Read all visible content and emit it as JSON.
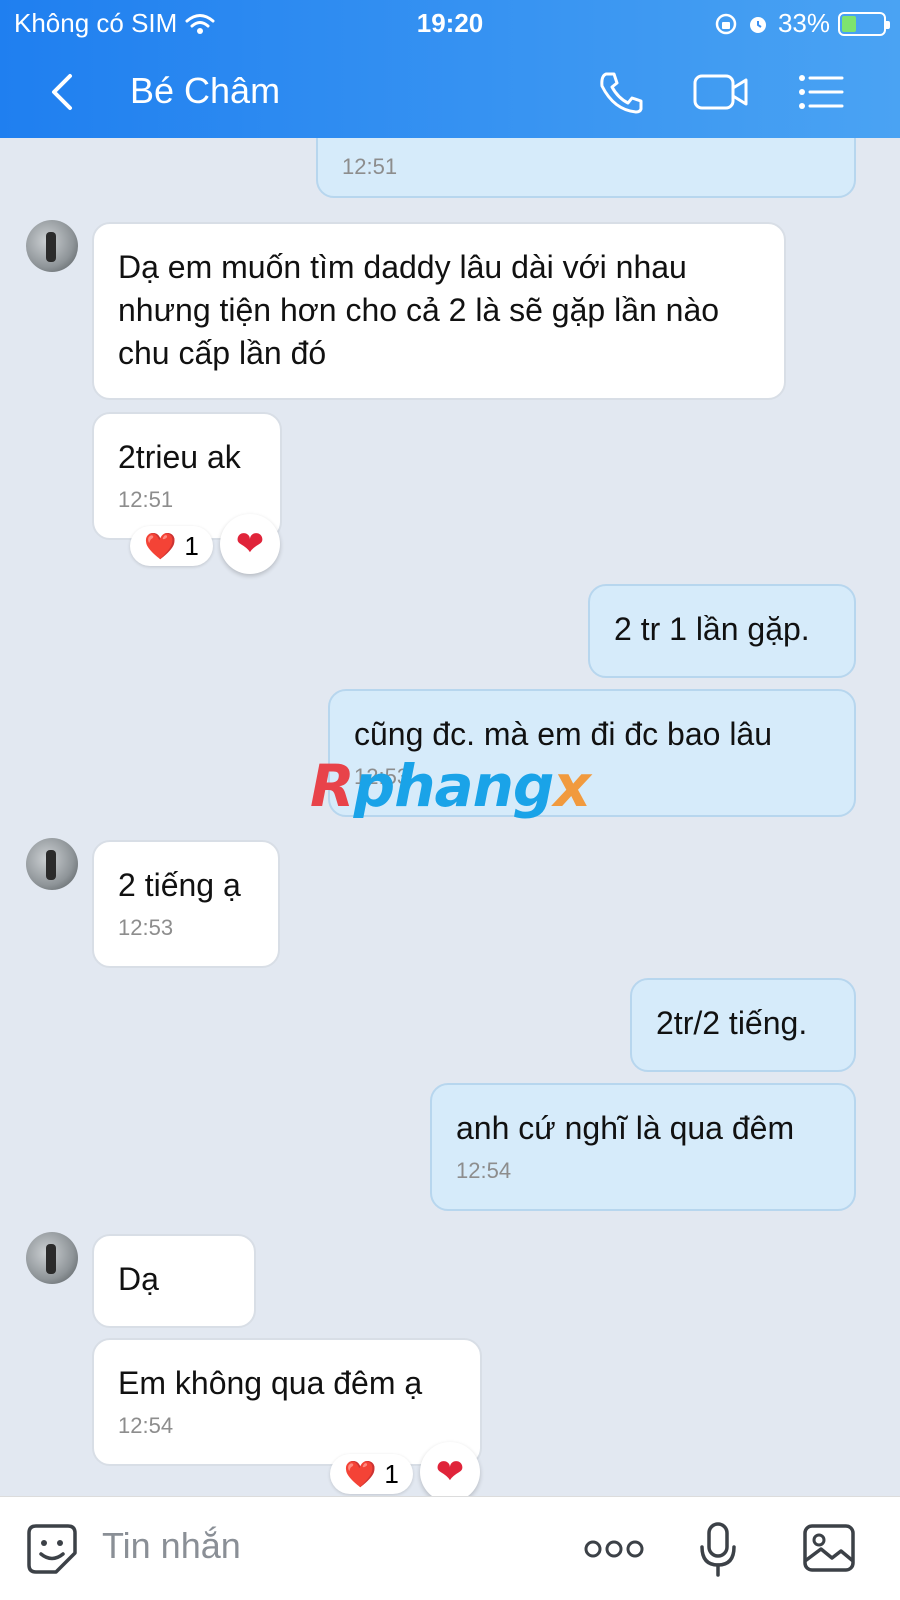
{
  "status_bar": {
    "carrier": "Không có SIM",
    "time": "19:20",
    "battery": "33%"
  },
  "header": {
    "contact_name": "Bé Châm"
  },
  "messages": [
    {
      "id": "m0",
      "side": "out",
      "text": "",
      "time": "12:51"
    },
    {
      "id": "m1",
      "side": "in",
      "text": "Dạ em muốn tìm daddy lâu dài với nhau nhưng tiện hơn cho cả 2 là sẽ gặp lần nào chu cấp lần đó",
      "time": ""
    },
    {
      "id": "m2",
      "side": "in",
      "text": "2trieu ak",
      "time": "12:51",
      "reaction": {
        "emoji": "❤️",
        "count": "1"
      }
    },
    {
      "id": "m3",
      "side": "out",
      "text": "2 tr 1 lần gặp.",
      "time": ""
    },
    {
      "id": "m4",
      "side": "out",
      "text": "cũng đc. mà em đi đc bao lâu",
      "time": "12:53"
    },
    {
      "id": "m5",
      "side": "in",
      "text": "2 tiếng ạ",
      "time": "12:53"
    },
    {
      "id": "m6",
      "side": "out",
      "text": "2tr/2 tiếng.",
      "time": ""
    },
    {
      "id": "m7",
      "side": "out",
      "text": "anh cứ nghĩ là qua đêm",
      "time": "12:54"
    },
    {
      "id": "m8",
      "side": "in",
      "text": "Dạ",
      "time": ""
    },
    {
      "id": "m9",
      "side": "in",
      "text": "Em không qua đêm ạ",
      "time": "12:54",
      "reaction": {
        "emoji": "❤️",
        "count": "1"
      }
    }
  ],
  "watermark": {
    "part1": "R",
    "part2": "phang",
    "part3": "x"
  },
  "input": {
    "placeholder": "Tin nhắn"
  },
  "icons": {
    "back": "chevron-left-icon",
    "call": "phone-icon",
    "video": "video-camera-icon",
    "menu": "list-menu-icon",
    "sticker": "sticker-smile-icon",
    "more": "more-dots-icon",
    "mic": "microphone-icon",
    "image": "image-icon"
  },
  "colors": {
    "header_start": "#1f7ff0",
    "header_end": "#4aa3f3",
    "incoming_bubble": "#ffffff",
    "outgoing_bubble": "#d6ebfa",
    "chat_bg": "#e2e8f1"
  }
}
